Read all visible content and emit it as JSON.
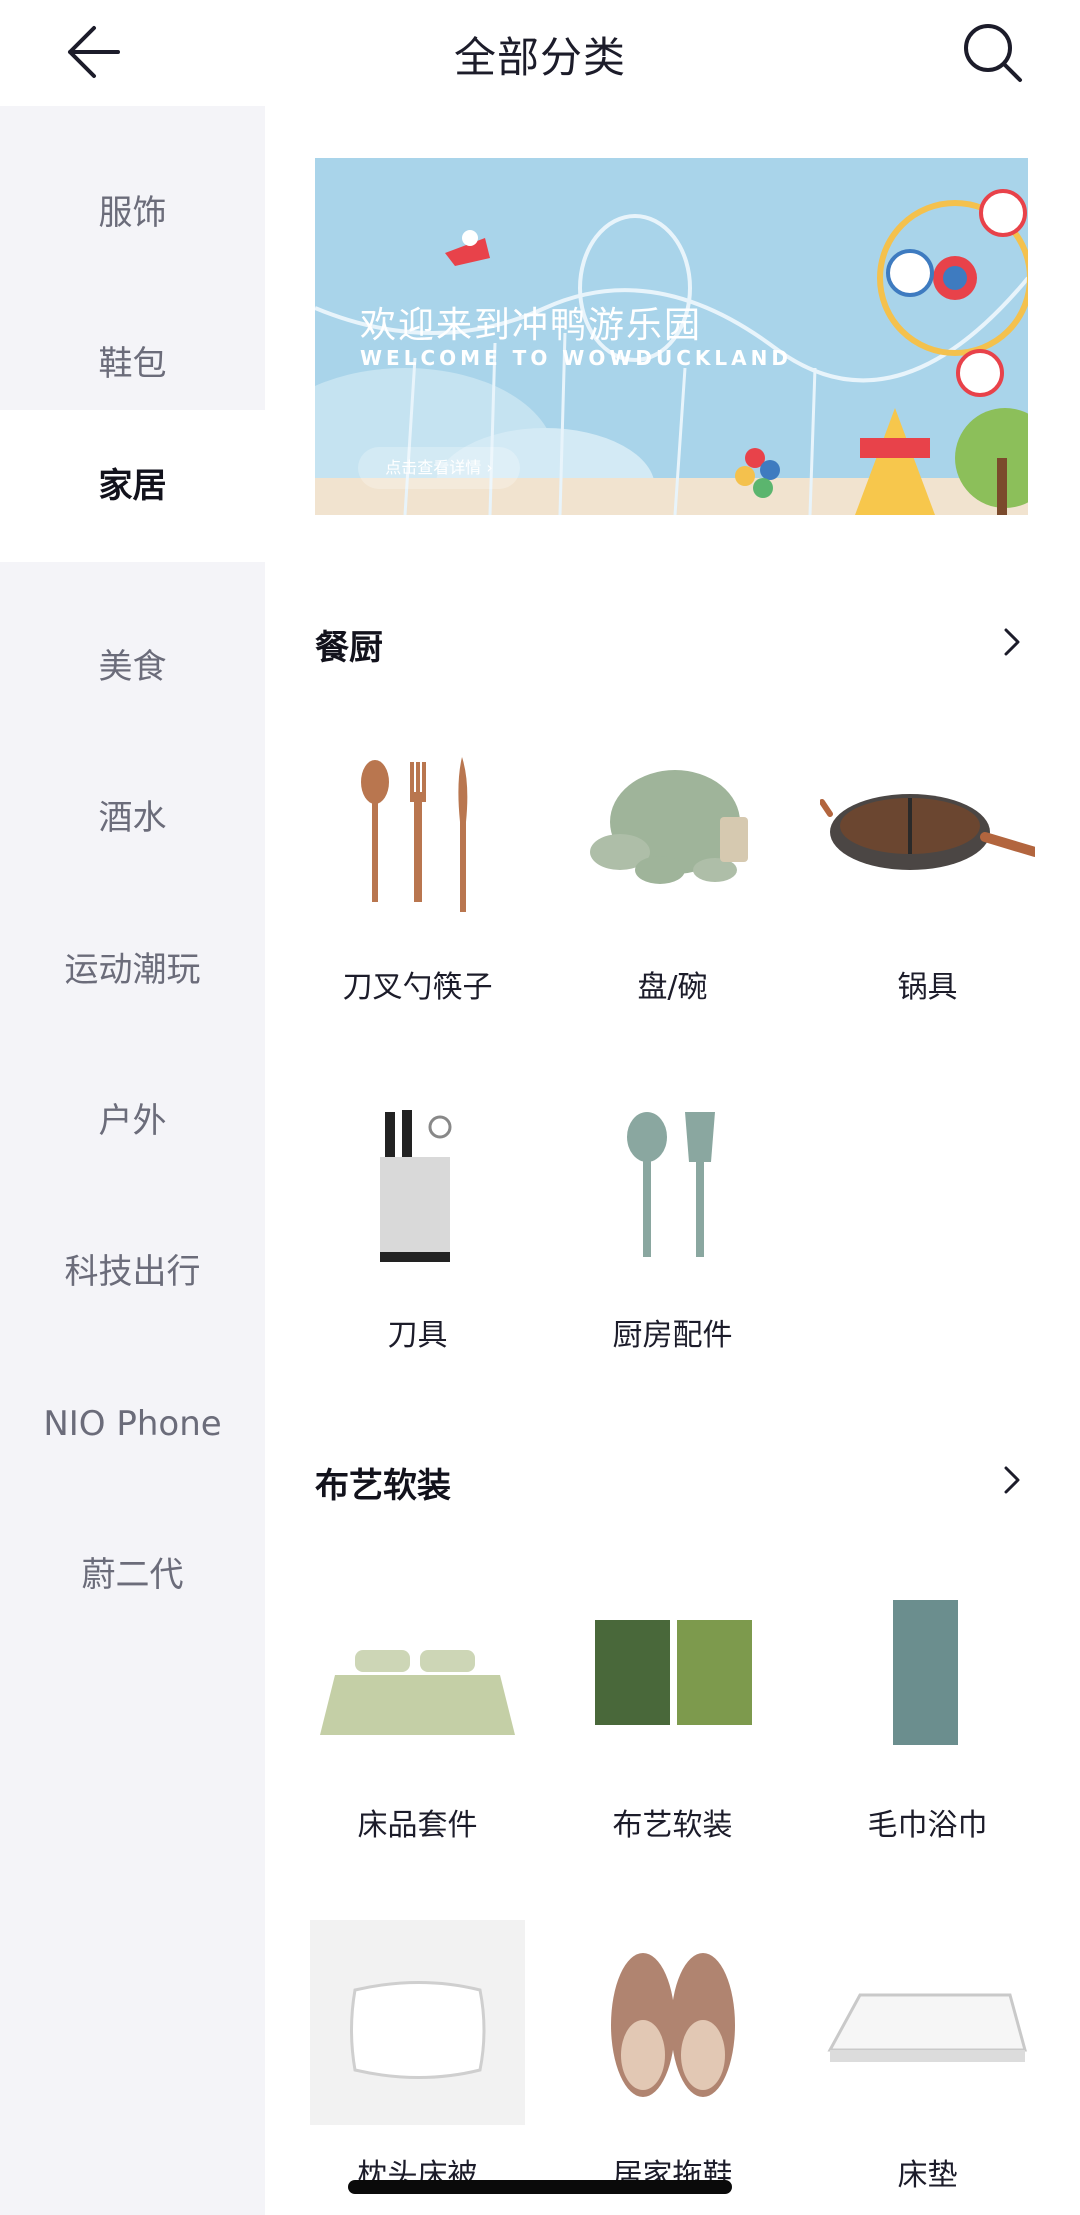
{
  "header": {
    "title": "全部分类",
    "back_icon": "arrow-left-icon",
    "search_icon": "search-icon"
  },
  "sidebar": {
    "items": [
      {
        "label": "服饰"
      },
      {
        "label": "鞋包"
      },
      {
        "label": "家居",
        "active": true
      },
      {
        "label": "美食"
      },
      {
        "label": "酒水"
      },
      {
        "label": "运动潮玩"
      },
      {
        "label": "户外"
      },
      {
        "label": "科技出行"
      },
      {
        "label": "NIO Phone"
      },
      {
        "label": "蔚二代"
      }
    ]
  },
  "banner": {
    "title": "欢迎来到冲鸭游乐园",
    "subtitle": "WELCOME TO WOWDUCKLAND",
    "button": "点击查看详情 ›"
  },
  "sections": [
    {
      "title": "餐厨",
      "items": [
        {
          "label": "刀叉勺筷子",
          "icon": "cutlery-icon"
        },
        {
          "label": "盘/碗",
          "icon": "bowl-plate-icon"
        },
        {
          "label": "锅具",
          "icon": "wok-icon"
        },
        {
          "label": "刀具",
          "icon": "knife-block-icon"
        },
        {
          "label": "厨房配件",
          "icon": "kitchen-utensils-icon"
        }
      ]
    },
    {
      "title": "布艺软装",
      "items": [
        {
          "label": "床品套件",
          "icon": "bedding-icon"
        },
        {
          "label": "布艺软装",
          "icon": "rug-icon"
        },
        {
          "label": "毛巾浴巾",
          "icon": "towel-icon"
        },
        {
          "label": "枕头床被",
          "icon": "pillow-icon"
        },
        {
          "label": "居家拖鞋",
          "icon": "slippers-icon"
        },
        {
          "label": "床垫",
          "icon": "mattress-icon"
        }
      ]
    }
  ],
  "colors": {
    "accent": "#1c1c2a",
    "sidebar_bg": "#f4f4f8",
    "banner_sky": "#a9d4ea"
  }
}
